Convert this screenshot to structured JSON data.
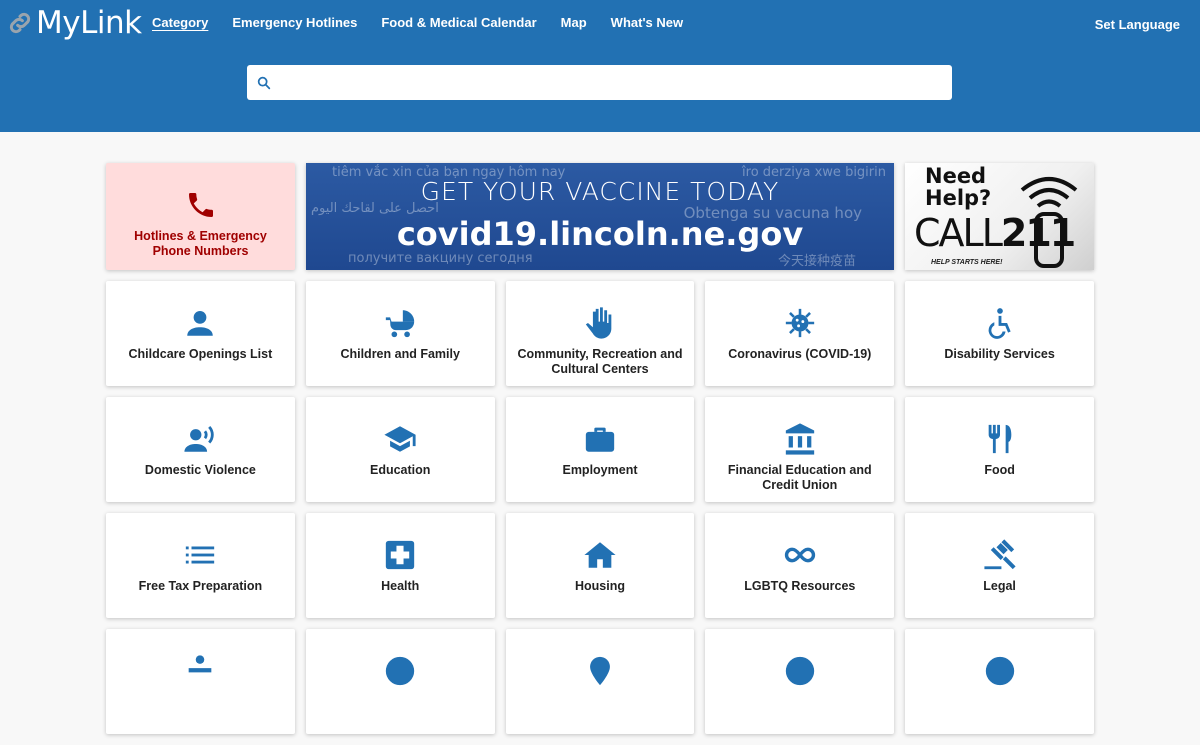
{
  "header": {
    "logo_text": "MyLink",
    "nav": [
      {
        "label": "Category",
        "active": true
      },
      {
        "label": "Emergency Hotlines",
        "active": false
      },
      {
        "label": "Food & Medical Calendar",
        "active": false
      },
      {
        "label": "Map",
        "active": false
      },
      {
        "label": "What's New",
        "active": false
      }
    ],
    "set_language": "Set Language",
    "search": {
      "placeholder": "",
      "value": "",
      "icon": "search-icon"
    },
    "brand_color": "#2271b3"
  },
  "featured": {
    "hotline": {
      "label": "Hotlines & Emergency Phone Numbers",
      "icon": "phone-icon",
      "bg_color": "#ffdcdc",
      "text_color": "#a00000"
    },
    "vaccine_banner": {
      "headline": "GET YOUR VACCINE TODAY",
      "url": "covid19.lincoln.ne.gov",
      "translations": [
        "tiêm vắc xin của bạn ngay hôm nay",
        "îro derziya xwe bigirin",
        "احصل على لقاحك اليوم",
        "Obtenga su vacuna hoy",
        "получите вакцину сегодня",
        "今天接种疫苗"
      ]
    },
    "call211": {
      "line1": "Need",
      "line2": "Help?",
      "call": "CALL",
      "number": "211",
      "tagline": "HELP STARTS HERE!"
    }
  },
  "categories": [
    {
      "label": "Childcare Openings List",
      "icon": "person-icon"
    },
    {
      "label": "Children and Family",
      "icon": "stroller-icon"
    },
    {
      "label": "Community, Recreation and Cultural Centers",
      "icon": "hand-icon"
    },
    {
      "label": "Coronavirus (COVID-19)",
      "icon": "virus-icon"
    },
    {
      "label": "Disability Services",
      "icon": "wheelchair-icon"
    },
    {
      "label": "Domestic Violence",
      "icon": "speaking-person-icon"
    },
    {
      "label": "Education",
      "icon": "graduation-cap-icon"
    },
    {
      "label": "Employment",
      "icon": "briefcase-icon"
    },
    {
      "label": "Financial Education and Credit Union",
      "icon": "bank-icon"
    },
    {
      "label": "Food",
      "icon": "utensils-icon"
    },
    {
      "label": "Free Tax Preparation",
      "icon": "list-icon"
    },
    {
      "label": "Health",
      "icon": "medical-cross-icon"
    },
    {
      "label": "Housing",
      "icon": "house-icon"
    },
    {
      "label": "LGBTQ Resources",
      "icon": "infinity-icon"
    },
    {
      "label": "Legal",
      "icon": "gavel-icon"
    }
  ]
}
